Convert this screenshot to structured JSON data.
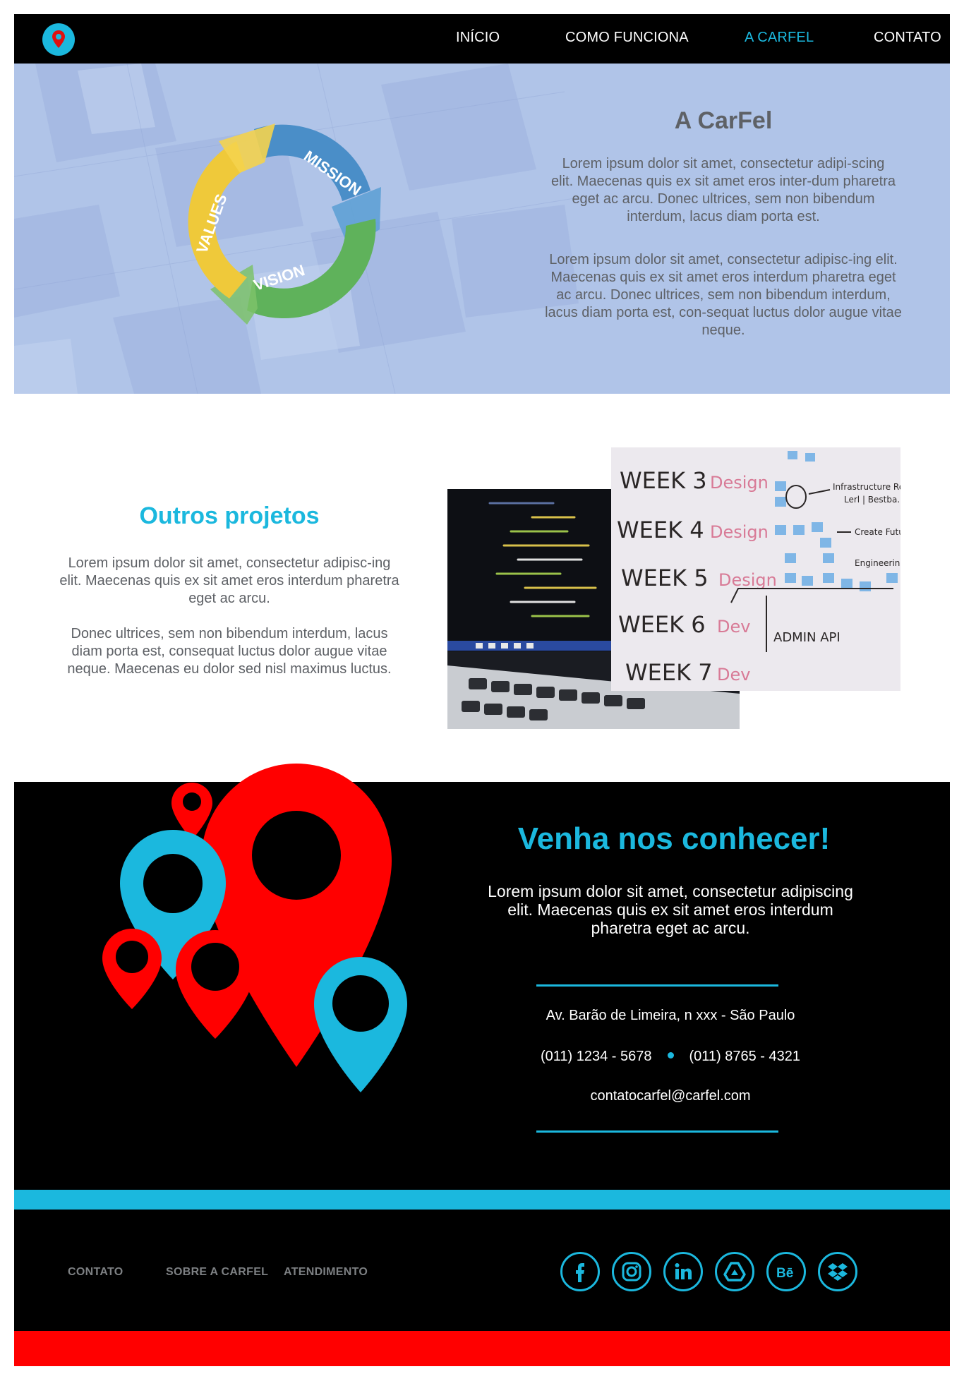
{
  "nav": {
    "logo_icon": "map-pin-icon",
    "items": [
      {
        "label": "INÍCIO",
        "active": false
      },
      {
        "label": "COMO FUNCIONA",
        "active": false
      },
      {
        "label": "A CARFEL",
        "active": true
      },
      {
        "label": "CONTATO",
        "active": false
      }
    ]
  },
  "hero": {
    "title": "A CarFel",
    "cycle_labels": {
      "mission": "MISSION",
      "vision": "VISION",
      "values": "VALUES"
    },
    "paragraph1": "Lorem ipsum dolor sit amet, consectetur adipi-scing elit. Maecenas quis ex sit amet eros inter-dum pharetra eget ac arcu. Donec ultrices, sem non bibendum interdum, lacus diam porta est.",
    "paragraph2": "Lorem ipsum dolor sit amet, consectetur adipisc-ing elit. Maecenas quis ex sit amet eros interdum pharetra eget ac arcu. Donec ultrices, sem non bibendum interdum, lacus diam porta est, con-sequat luctus dolor augue vitae neque."
  },
  "projects": {
    "title": "Outros projetos",
    "paragraph1": "Lorem ipsum dolor sit amet, consectetur adipisc-ing elit. Maecenas quis ex sit amet eros interdum pharetra eget ac arcu.",
    "paragraph2": "Donec ultrices, sem non bibendum interdum, lacus diam porta est, consequat luctus dolor augue vitae neque. Maecenas eu dolor sed nisl maximus luctus.",
    "whiteboard_lines": [
      "WEEK 3",
      "WEEK 4",
      "WEEK 5",
      "WEEK 6",
      "WEEK 7"
    ],
    "whiteboard_tags": [
      "Design",
      "Design",
      "Design",
      "Dev",
      "Dev"
    ],
    "whiteboard_note": "ADMIN API"
  },
  "contact": {
    "title": "Venha nos conhecer!",
    "paragraph": "Lorem ipsum dolor sit amet, consectetur adipiscing elit. Maecenas quis ex sit amet eros interdum pharetra eget ac arcu.",
    "address": "Av.  Barão de Limeira, n xxx - São Paulo",
    "phone1": "(011) 1234 - 5678",
    "phone2": "(011) 8765 - 4321",
    "email": "contatocarfel@carfel.com"
  },
  "footer": {
    "links": [
      "CONTATO",
      "SOBRE A CARFEL",
      "ATENDIMENTO"
    ],
    "social": [
      "facebook-icon",
      "instagram-icon",
      "linkedin-icon",
      "google-drive-icon",
      "behance-icon",
      "dropbox-icon"
    ]
  },
  "colors": {
    "accent_blue": "#1bb8de",
    "accent_red": "#ff0000",
    "hero_bg": "#b0c4e8",
    "text_gray": "#5e6166",
    "footer_link": "#7d8083"
  }
}
